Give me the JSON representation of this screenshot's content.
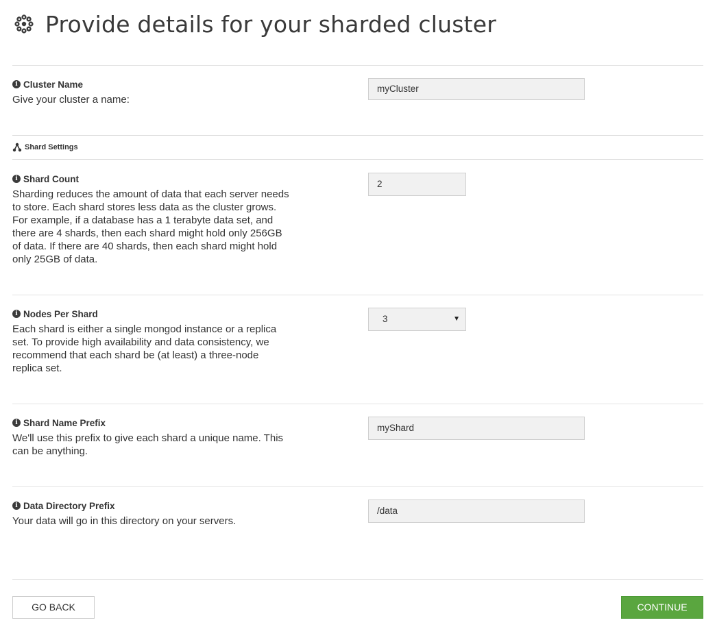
{
  "header": {
    "title": "Provide details for your sharded cluster",
    "icon": "cluster-flower-icon"
  },
  "fields": {
    "cluster_name": {
      "title": "Cluster Name",
      "description": "Give your cluster a name:",
      "value": "myCluster"
    },
    "shard_count": {
      "title": "Shard Count",
      "description": "Sharding reduces the amount of data that each server needs to store. Each shard stores less data as the cluster grows. For example, if a database has a 1 terabyte data set, and there are 4 shards, then each shard might hold only 256GB of data. If there are 40 shards, then each shard might hold only 25GB of data.",
      "value": "2"
    },
    "nodes_per_shard": {
      "title": "Nodes Per Shard",
      "description": "Each shard is either a single mongod instance or a replica set. To provide high availability and data consistency, we recommend that each shard be (at least) a three-node replica set.",
      "value": "3"
    },
    "shard_name_prefix": {
      "title": "Shard Name Prefix",
      "description": "We'll use this prefix to give each shard a unique name. This can be anything.",
      "value": "myShard"
    },
    "data_directory_prefix": {
      "title": "Data Directory Prefix",
      "description": "Your data will go in this directory on your servers.",
      "value": "/data"
    }
  },
  "section": {
    "shard_settings": "Shard Settings",
    "icon": "shard-network-icon"
  },
  "info_icon_glyph": "i",
  "select_arrow_glyph": "▼",
  "buttons": {
    "back": "GO BACK",
    "continue": "CONTINUE"
  },
  "colors": {
    "continue_bg": "#5aa63f",
    "input_bg": "#f1f1f1"
  }
}
